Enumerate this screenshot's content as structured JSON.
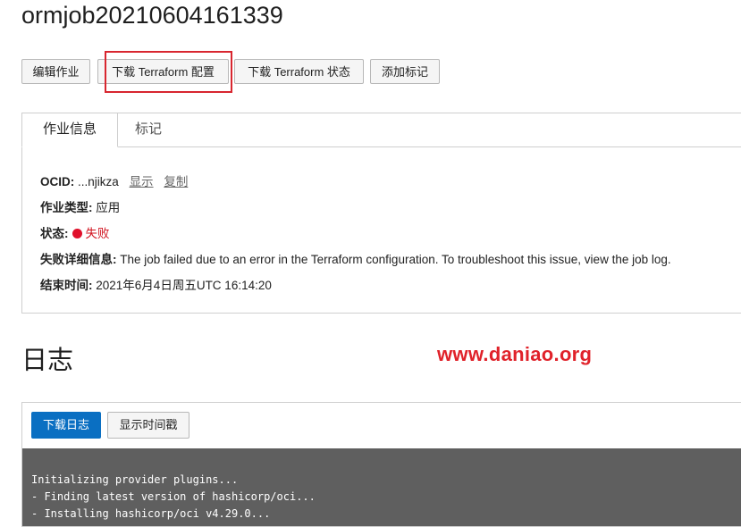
{
  "header": {
    "title": "ormjob20210604161339"
  },
  "toolbar": {
    "edit_job": "编辑作业",
    "download_config": "下载 Terraform 配置",
    "download_state": "下载 Terraform 状态",
    "add_tags": "添加标记"
  },
  "tabs": {
    "job_info": "作业信息",
    "tags": "标记"
  },
  "details": {
    "ocid_label": "OCID:",
    "ocid_value": "...njikza",
    "ocid_show": "显示",
    "ocid_copy": "复制",
    "job_type_label": "作业类型:",
    "job_type_value": "应用",
    "state_label": "状态:",
    "state_value": "失败",
    "failure_label": "失败详细信息:",
    "failure_value": "The job failed due to an error in the Terraform configuration. To troubleshoot this issue, view the job log.",
    "finished_label": "结束时间:",
    "finished_value": "2021年6月4日周五UTC 16:14:20"
  },
  "logs": {
    "title": "日志",
    "download_button": "下载日志",
    "show_timestamps_button": "显示时间戳",
    "lines": [
      "Initializing provider plugins...",
      "- Finding latest version of hashicorp/oci...",
      "- Installing hashicorp/oci v4.29.0..."
    ]
  },
  "watermark": "www.daniao.org",
  "colors": {
    "primary": "#0a6fc2",
    "error": "#e0102b",
    "highlight": "#d8262f",
    "terminal_bg": "#5f5f5f"
  }
}
